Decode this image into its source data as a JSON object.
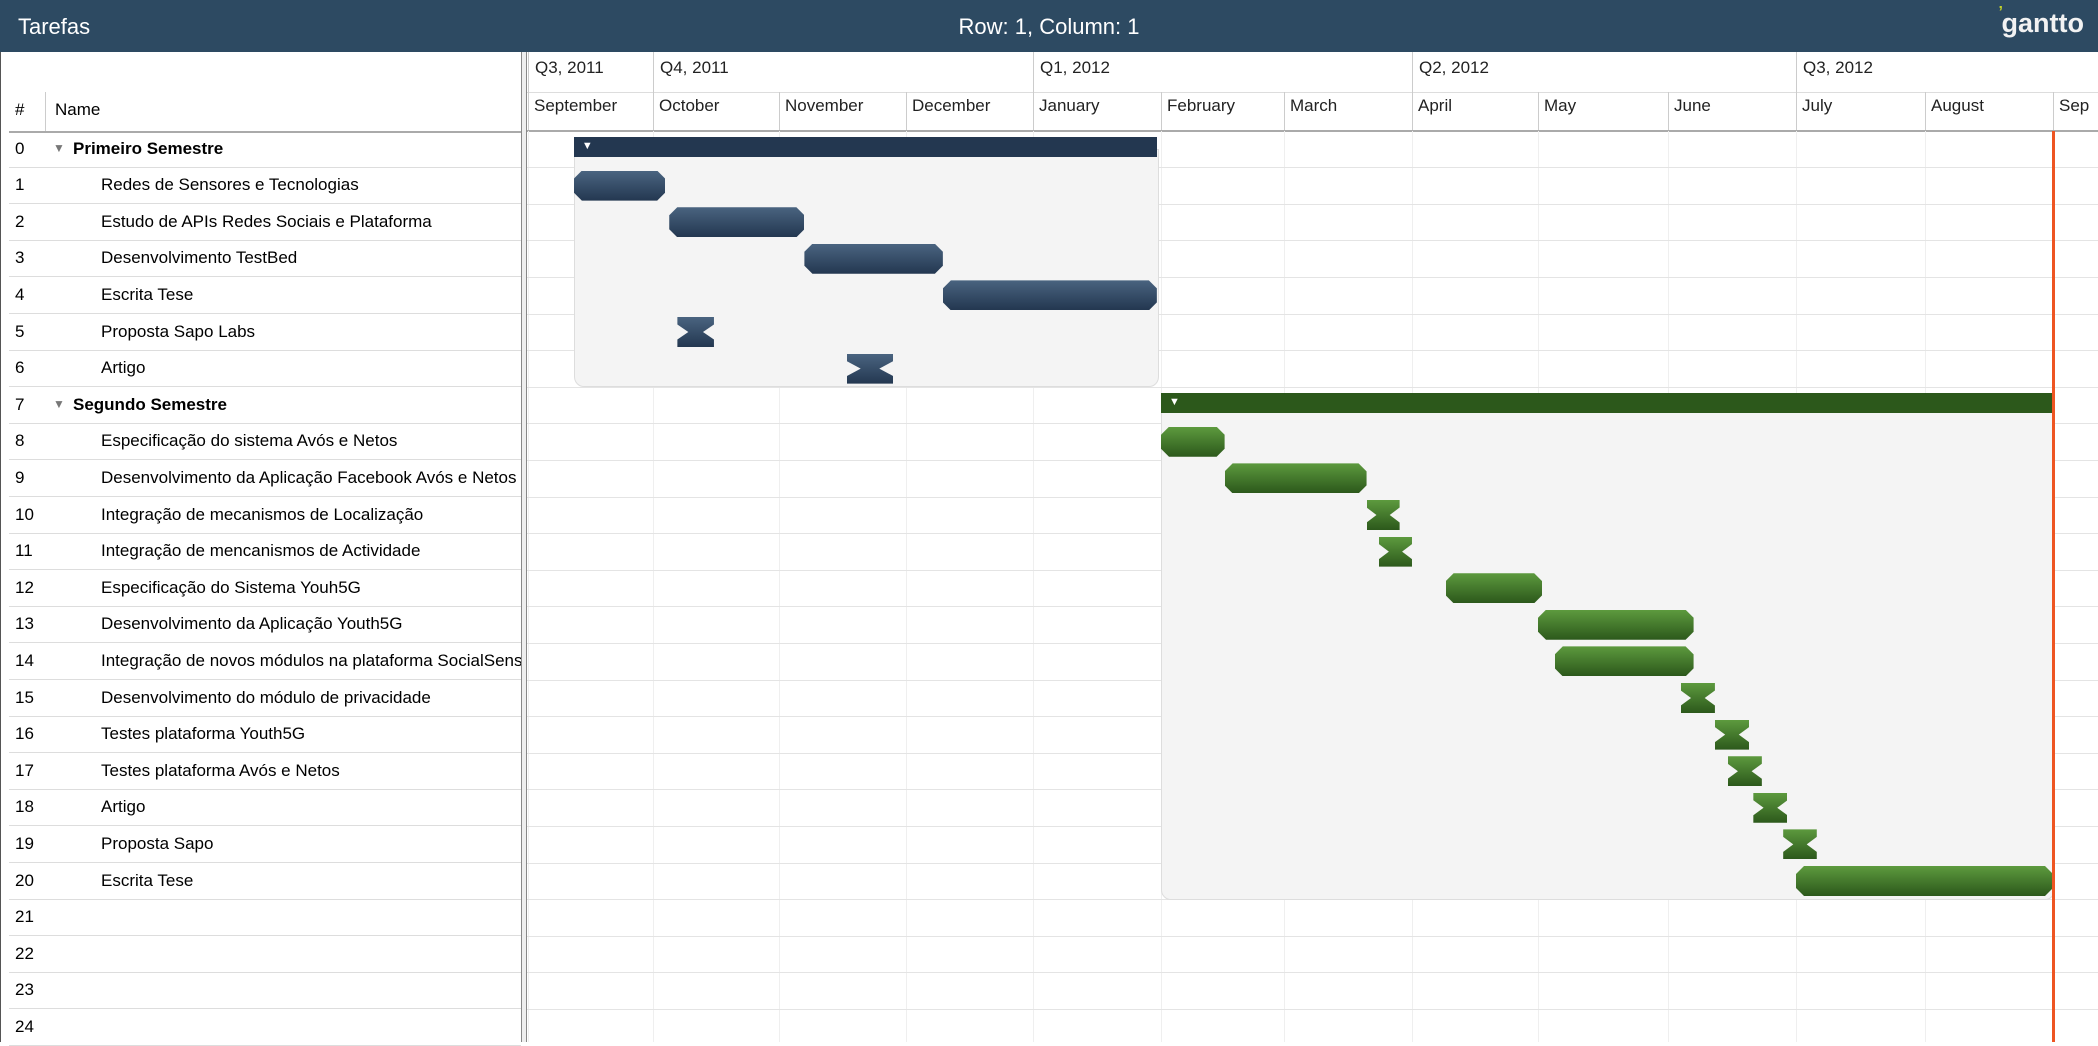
{
  "app": {
    "panel_title": "Tarefas",
    "cell_status": "Row: 1, Column: 1",
    "logo": "gantto"
  },
  "grid": {
    "col_num": "#",
    "col_name": "Name",
    "rows": [
      {
        "num": "0",
        "name": "Primeiro Semestre",
        "group": true
      },
      {
        "num": "1",
        "name": "Redes de Sensores e Tecnologias"
      },
      {
        "num": "2",
        "name": "Estudo de APIs Redes Sociais e Plataforma"
      },
      {
        "num": "3",
        "name": "Desenvolvimento TestBed"
      },
      {
        "num": "4",
        "name": "Escrita Tese"
      },
      {
        "num": "5",
        "name": "Proposta Sapo Labs"
      },
      {
        "num": "6",
        "name": "Artigo"
      },
      {
        "num": "7",
        "name": "Segundo Semestre",
        "group": true
      },
      {
        "num": "8",
        "name": "Especificação do sistema Avós e Netos"
      },
      {
        "num": "9",
        "name": "Desenvolvimento da Aplicação Facebook Avós e Netos"
      },
      {
        "num": "10",
        "name": "Integração de mecanismos de Localização"
      },
      {
        "num": "11",
        "name": "Integração de mencanismos de Actividade"
      },
      {
        "num": "12",
        "name": "Especificação do Sistema Youh5G"
      },
      {
        "num": "13",
        "name": "Desenvolvimento da Aplicação Youth5G"
      },
      {
        "num": "14",
        "name": "Integração de novos módulos na plataforma SocialSense"
      },
      {
        "num": "15",
        "name": "Desenvolvimento do módulo de privacidade"
      },
      {
        "num": "16",
        "name": "Testes plataforma Youth5G"
      },
      {
        "num": "17",
        "name": "Testes plataforma Avós e Netos"
      },
      {
        "num": "18",
        "name": "Artigo"
      },
      {
        "num": "19",
        "name": "Proposta Sapo"
      },
      {
        "num": "20",
        "name": "Escrita Tese"
      },
      {
        "num": "21",
        "name": ""
      },
      {
        "num": "22",
        "name": ""
      },
      {
        "num": "23",
        "name": ""
      },
      {
        "num": "24",
        "name": ""
      }
    ]
  },
  "timeline": {
    "quarters": [
      "Q3, 2011",
      "Q4, 2011",
      "Q1, 2012",
      "Q2, 2012",
      "Q3, 2012"
    ],
    "months": [
      "September",
      "October",
      "November",
      "December",
      "January",
      "February",
      "March",
      "April",
      "May",
      "June",
      "July",
      "August",
      "Sep"
    ]
  },
  "colors": {
    "header_bg": "#2d4a62",
    "phase1_bar": "#233750",
    "phase2_bar": "#2c581b",
    "today_line": "#ee5522",
    "logo_accent": "#c3d32a"
  },
  "tasks": [
    {
      "row": 0,
      "kind": "summary",
      "color": "blue",
      "start": "2011-09-12",
      "end": "2012-01-31"
    },
    {
      "row": 1,
      "kind": "task",
      "color": "blue",
      "start": "2011-09-12",
      "end": "2011-10-04"
    },
    {
      "row": 2,
      "kind": "task",
      "color": "blue",
      "start": "2011-10-05",
      "end": "2011-11-07"
    },
    {
      "row": 3,
      "kind": "task",
      "color": "blue",
      "start": "2011-11-07",
      "end": "2011-12-10"
    },
    {
      "row": 4,
      "kind": "task",
      "color": "blue",
      "start": "2011-12-10",
      "end": "2012-01-31"
    },
    {
      "row": 5,
      "kind": "milestone",
      "color": "blue",
      "start": "2011-10-07",
      "end": "2011-10-16"
    },
    {
      "row": 6,
      "kind": "milestone",
      "color": "blue",
      "start": "2011-11-17",
      "end": "2011-11-28"
    },
    {
      "row": 7,
      "kind": "summary",
      "color": "green",
      "start": "2012-02-01",
      "end": "2012-09-01"
    },
    {
      "row": 8,
      "kind": "task",
      "color": "green",
      "start": "2012-02-01",
      "end": "2012-02-16"
    },
    {
      "row": 9,
      "kind": "task",
      "color": "green",
      "start": "2012-02-16",
      "end": "2012-03-21"
    },
    {
      "row": 10,
      "kind": "milestone",
      "color": "green",
      "start": "2012-03-21",
      "end": "2012-03-29"
    },
    {
      "row": 11,
      "kind": "milestone",
      "color": "green",
      "start": "2012-03-24",
      "end": "2012-04-01"
    },
    {
      "row": 12,
      "kind": "task",
      "color": "green",
      "start": "2012-04-09",
      "end": "2012-05-02"
    },
    {
      "row": 13,
      "kind": "task",
      "color": "green",
      "start": "2012-05-01",
      "end": "2012-06-07"
    },
    {
      "row": 14,
      "kind": "task",
      "color": "green",
      "start": "2012-05-05",
      "end": "2012-06-07"
    },
    {
      "row": 15,
      "kind": "milestone",
      "color": "green",
      "start": "2012-06-04",
      "end": "2012-06-12"
    },
    {
      "row": 16,
      "kind": "milestone",
      "color": "green",
      "start": "2012-06-12",
      "end": "2012-06-20"
    },
    {
      "row": 17,
      "kind": "milestone",
      "color": "green",
      "start": "2012-06-15",
      "end": "2012-06-23"
    },
    {
      "row": 18,
      "kind": "milestone",
      "color": "green",
      "start": "2012-06-21",
      "end": "2012-06-29"
    },
    {
      "row": 19,
      "kind": "milestone",
      "color": "green",
      "start": "2012-06-28",
      "end": "2012-07-06"
    },
    {
      "row": 20,
      "kind": "task",
      "color": "green",
      "start": "2012-07-01",
      "end": "2012-09-01"
    }
  ],
  "today": "2012-09-01"
}
